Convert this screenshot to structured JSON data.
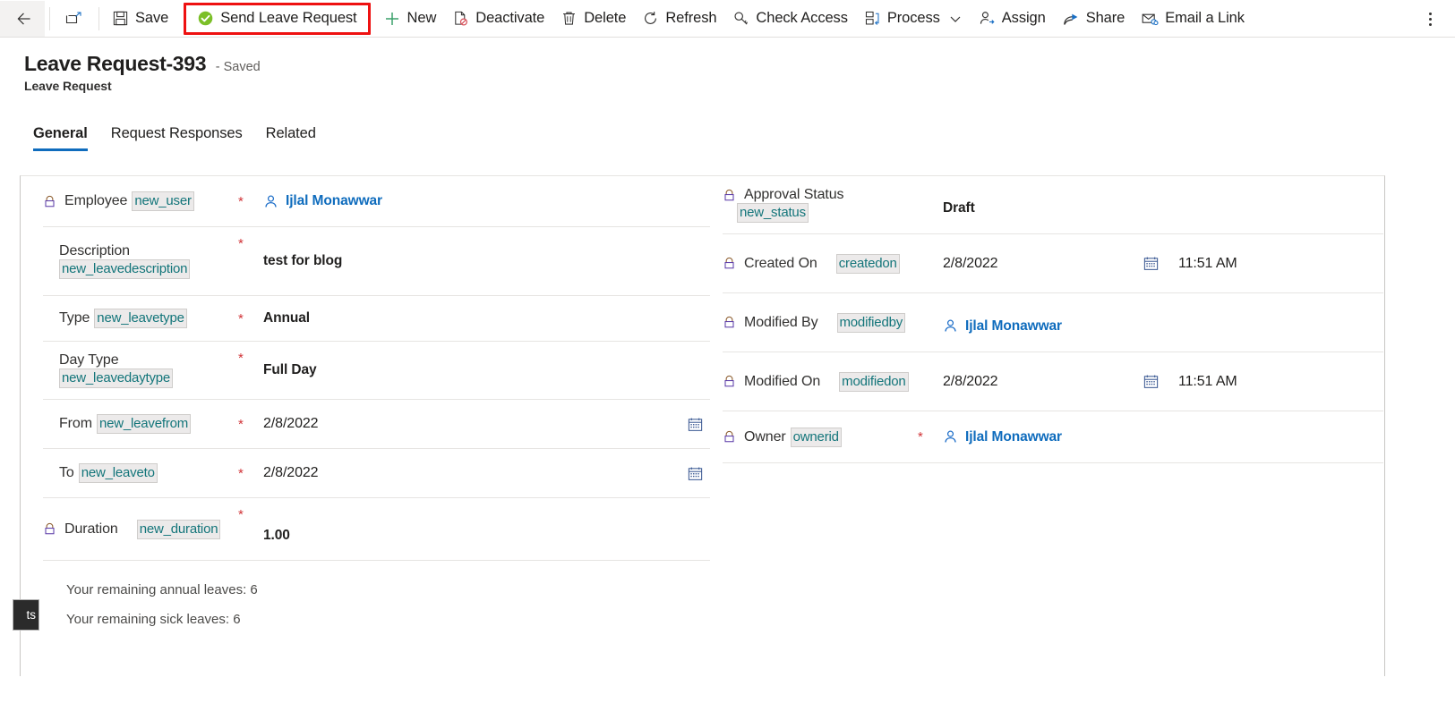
{
  "commandbar": {
    "back_label": "",
    "popout_label": "",
    "buttons": [
      {
        "id": "save",
        "label": "Save",
        "icon": "save-icon"
      },
      {
        "id": "send-leave-request",
        "label": "Send Leave Request",
        "icon": "green-check-circle-icon",
        "highlighted": true,
        "highlight_color": "#ee1111"
      },
      {
        "id": "new",
        "label": "New",
        "icon": "plus-icon"
      },
      {
        "id": "deactivate",
        "label": "Deactivate",
        "icon": "deactivate-icon"
      },
      {
        "id": "delete",
        "label": "Delete",
        "icon": "trash-icon"
      },
      {
        "id": "refresh",
        "label": "Refresh",
        "icon": "refresh-icon"
      },
      {
        "id": "check-access",
        "label": "Check Access",
        "icon": "key-icon"
      },
      {
        "id": "process",
        "label": "Process",
        "icon": "process-icon",
        "has_chevron": true
      },
      {
        "id": "assign",
        "label": "Assign",
        "icon": "assign-person-icon"
      },
      {
        "id": "share",
        "label": "Share",
        "icon": "share-icon"
      },
      {
        "id": "email-a-link",
        "label": "Email a Link",
        "icon": "email-link-icon"
      }
    ],
    "overflow_label": "More commands"
  },
  "header": {
    "title": "Leave Request-393",
    "saved_state": "- Saved",
    "subtitle": "Leave Request"
  },
  "tabs": [
    {
      "label": "General",
      "active": true
    },
    {
      "label": "Request Responses",
      "active": false
    },
    {
      "label": "Related",
      "active": false
    }
  ],
  "left_column": {
    "employee": {
      "label": "Employee",
      "schema": "new_user",
      "required": "*",
      "value": "Ijlal Monawwar",
      "locked": true
    },
    "description": {
      "label": "Description",
      "schema": "new_leavedescription",
      "required": "*",
      "value": "test for blog",
      "locked": false
    },
    "type": {
      "label": "Type",
      "schema": "new_leavetype",
      "required": "*",
      "value": "Annual",
      "locked": false
    },
    "day_type": {
      "label": "Day Type",
      "schema": "new_leavedaytype",
      "required": "*",
      "value": "Full Day",
      "locked": false
    },
    "from": {
      "label": "From",
      "schema": "new_leavefrom",
      "required": "*",
      "value": "2/8/2022",
      "locked": false
    },
    "to": {
      "label": "To",
      "schema": "new_leaveto",
      "required": "*",
      "value": "2/8/2022",
      "locked": false
    },
    "duration": {
      "label": "Duration",
      "schema": "new_duration",
      "required": "*",
      "value": "1.00",
      "locked": true
    },
    "note_annual": "Your remaining annual leaves: 6",
    "note_sick": "Your remaining sick leaves: 6"
  },
  "right_column": {
    "approval_status": {
      "label": "Approval Status",
      "schema": "new_status",
      "required": "",
      "value": "Draft",
      "locked": true
    },
    "created_on": {
      "label": "Created On",
      "schema": "createdon",
      "required": "",
      "value": "2/8/2022",
      "time": "11:51 AM",
      "locked": true
    },
    "modified_by": {
      "label": "Modified By",
      "schema": "modifiedby",
      "required": "",
      "value": "Ijlal Monawwar",
      "locked": true
    },
    "modified_on": {
      "label": "Modified On",
      "schema": "modifiedon",
      "required": "",
      "value": "2/8/2022",
      "time": "11:51 AM",
      "locked": true
    },
    "owner": {
      "label": "Owner",
      "schema": "ownerid",
      "required": "*",
      "value": "Ijlal Monawwar",
      "locked": true
    }
  },
  "edge_tooltip": {
    "text": "ts"
  },
  "colors": {
    "accent": "#0f6cbd",
    "schema_text": "#13757a",
    "schema_bg": "#eceaea",
    "required": "#d13438",
    "highlight_border": "#ee1111",
    "success_green": "#6bb700"
  }
}
